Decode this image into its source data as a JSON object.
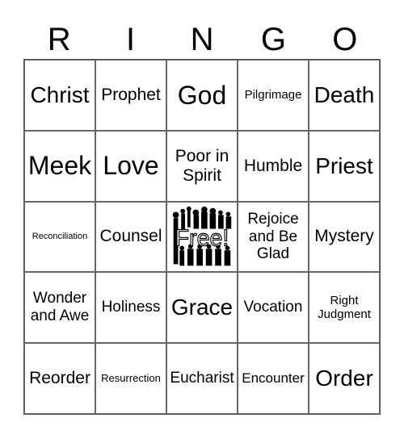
{
  "header": [
    "R",
    "I",
    "N",
    "G",
    "O"
  ],
  "cells": [
    {
      "text": "Christ",
      "size": "lg"
    },
    {
      "text": "Prophet",
      "size": "md"
    },
    {
      "text": "God",
      "size": "xl"
    },
    {
      "text": "Pilgrimage",
      "size": "xxs"
    },
    {
      "text": "Death",
      "size": "lg"
    },
    {
      "text": "Meek",
      "size": "xl"
    },
    {
      "text": "Love",
      "size": "xl"
    },
    {
      "text": "Poor in Spirit",
      "size": "md"
    },
    {
      "text": "Humble",
      "size": "md"
    },
    {
      "text": "Priest",
      "size": "lg"
    },
    {
      "text": "Reconciliation",
      "size": "mini"
    },
    {
      "text": "Counsel",
      "size": "md"
    },
    {
      "text": "Free!",
      "size": "free",
      "free": true
    },
    {
      "text": "Rejoice and Be Glad",
      "size": "sm"
    },
    {
      "text": "Mystery",
      "size": "md"
    },
    {
      "text": "Wonder and Awe",
      "size": "sm"
    },
    {
      "text": "Holiness",
      "size": "sm"
    },
    {
      "text": "Grace",
      "size": "lg"
    },
    {
      "text": "Vocation",
      "size": "sm"
    },
    {
      "text": "Right Judgment",
      "size": "xxs"
    },
    {
      "text": "Reorder",
      "size": "md"
    },
    {
      "text": "Resurrection",
      "size": "tiny"
    },
    {
      "text": "Eucharist",
      "size": "sm"
    },
    {
      "text": "Encounter",
      "size": "xs"
    },
    {
      "text": "Order",
      "size": "lg"
    }
  ],
  "free_space": {
    "icon": "crowd-silhouette-icon",
    "label": "Free!"
  }
}
